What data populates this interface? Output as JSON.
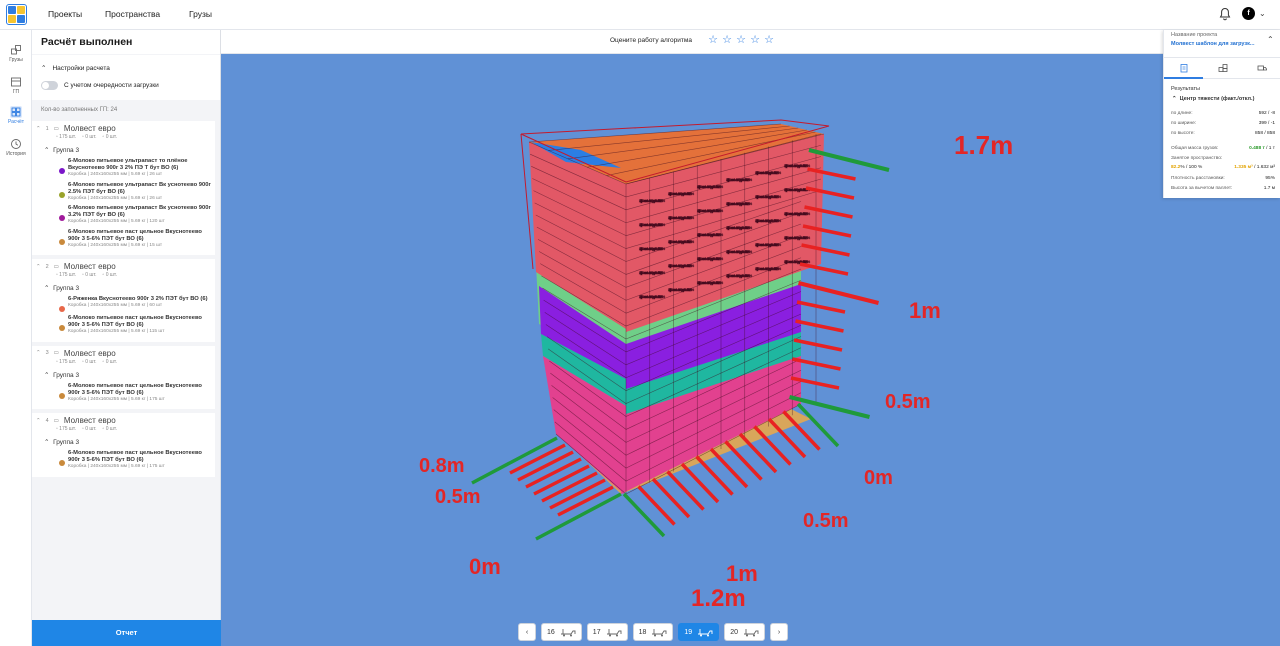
{
  "nav": {
    "items": [
      "Проекты",
      "Пространства",
      "Грузы"
    ],
    "user_initial": "f"
  },
  "rail": {
    "items": [
      {
        "label": "Грузы",
        "icon": "cargo-icon"
      },
      {
        "label": "ГП",
        "icon": "pallet-icon"
      },
      {
        "label": "Расчёт",
        "icon": "calculation-icon"
      },
      {
        "label": "История",
        "icon": "history-icon"
      }
    ]
  },
  "panel": {
    "title": "Расчёт выполнен",
    "settings_label": "Настройки расчета",
    "toggle_label": "С учетом очередности загрузки",
    "count_label": "Кол-во заполненных ГП: 24",
    "report_label": "Отчет",
    "cards": [
      {
        "index": "1",
        "name": "Молвест евро",
        "stats": [
          "175 шт.",
          "0 шт.",
          "0 шт."
        ],
        "group": "Группа 3",
        "items": [
          {
            "name": "6-Молоко питьевое ультрапаст то плёное Вкуснотеево 900г 3 2% ПЭ Т бут ВО (6)",
            "meta": "Коробка | 240x160x255 мм | 5.69 кг | 26 шт",
            "color": "#7b16c9"
          },
          {
            "name": "6-Молоко питьевое ультрапаст Вк уснотеево 900г 2.5% ПЭТ бут ВО (6)",
            "meta": "Коробка | 240x160x255 мм | 5.69 кг | 26 шт",
            "color": "#9aa32a"
          },
          {
            "name": "6-Молоко питьевое ультрапаст Вк уснотеево 900г 3.2% ПЭТ бут ВО (6)",
            "meta": "Коробка | 240x160x255 мм | 5.69 кг | 120 шт",
            "color": "#a01a9b"
          },
          {
            "name": "6-Молоко питьевое паст цельное Вкуснотеево 900г 3 5-6% ПЭТ бут ВО (6)",
            "meta": "Коробка | 240x160x255 мм | 5.69 кг | 15 шт",
            "color": "#c98a3c"
          }
        ]
      },
      {
        "index": "2",
        "name": "Молвест евро",
        "stats": [
          "175 шт.",
          "0 шт.",
          "0 шт."
        ],
        "group": "Группа 3",
        "items": [
          {
            "name": "6-Ряженка Вкуснотеево 900г 3 2% ПЭТ бут ВО (6)",
            "meta": "Коробка | 240x160x255 мм | 5.69 кг | 60 шт",
            "color": "#e8684a"
          },
          {
            "name": "6-Молоко питьевое паст цельное Вкуснотеево 900г 3 5-6% ПЭТ бут ВО (6)",
            "meta": "Коробка | 240x160x255 мм | 5.69 кг | 115 шт",
            "color": "#c98a3c"
          }
        ]
      },
      {
        "index": "3",
        "name": "Молвест евро",
        "stats": [
          "175 шт.",
          "0 шт.",
          "0 шт."
        ],
        "group": "Группа 3",
        "items": [
          {
            "name": "6-Молоко питьевое паст цельное Вкуснотеево 900г 3 5-6% ПЭТ бут ВО (6)",
            "meta": "Коробка | 240x160x255 мм | 5.69 кг | 175 шт",
            "color": "#c98a3c"
          }
        ]
      },
      {
        "index": "4",
        "name": "Молвест евро",
        "stats": [
          "175 шт.",
          "0 шт.",
          "0 шт."
        ],
        "group": "Группа 3",
        "items": [
          {
            "name": "6-Молоко питьевое паст цельное Вкуснотеево 900г 3 5-6% ПЭТ бут ВО (6)",
            "meta": "Коробка | 240x160x255 мм | 5.69 кг | 175 шт",
            "color": "#c98a3c"
          }
        ]
      }
    ]
  },
  "rating": {
    "label": "Оцените работу алгоритма",
    "stars": 5,
    "value": 0
  },
  "scene": {
    "axis_labels": [
      "1.7m",
      "1m",
      "0.5m",
      "0m",
      "0.5m",
      "1m",
      "1.2m",
      "0m",
      "0.5m",
      "0.8m"
    ],
    "box_label": "2,01 (кг) 6-Сметана Маяк Подрубный 300г 25%"
  },
  "pager": {
    "prev": "‹",
    "next": "›",
    "pages": [
      "16",
      "17",
      "18",
      "19",
      "20"
    ],
    "active": "19"
  },
  "results": {
    "project_label": "Название проекта",
    "project_value": "Молвест шаблон для загрузк...",
    "section": "Результаты",
    "cog_title": "Центр тяжести (факт./откл.)",
    "rows": [
      {
        "label": "по длине:",
        "value": "592 / -8"
      },
      {
        "label": "по ширине:",
        "value": "399 / -1"
      },
      {
        "label": "по высоте:",
        "value": "858 / 858"
      }
    ],
    "mass_label": "Общая масса грузов:",
    "mass_value": "0.488 т",
    "mass_rest": " / 1 т",
    "space_label": "Занятое пространство:",
    "space_pct": "82.2",
    "space_pct_rest": "% / 100 %",
    "space_vol": "1.335 м³",
    "space_vol_rest": " / 1.632 м³",
    "density_label": "Плотность расстановки:",
    "density_value": "95%",
    "height_label": "Высота за вычетом паллет:",
    "height_value": "1.7 м"
  },
  "colors": {
    "accent": "#1f86e6",
    "scene_bg": "#6091d6",
    "axis_red": "#e82222",
    "axis_green": "#1f9a3a",
    "layer_red": "#e25866",
    "layer_green": "#6fcf88",
    "layer_purple": "#8a1fe0",
    "layer_teal": "#1fb7a0",
    "layer_pink": "#e2418f",
    "top_orange": "#e4713a",
    "top_blue": "#2c7ee3",
    "pallet": "#d8a65b"
  }
}
